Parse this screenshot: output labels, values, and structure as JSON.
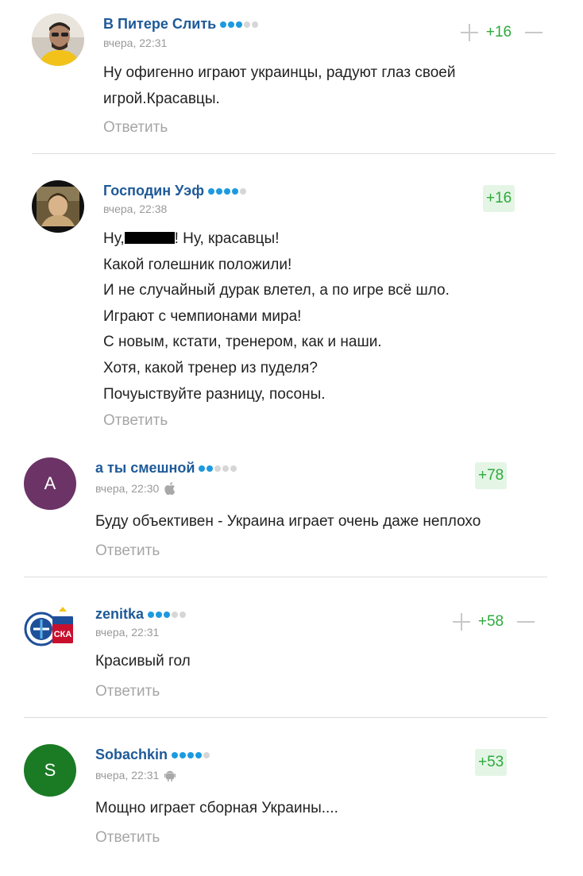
{
  "comments": [
    {
      "author": "В Питере Слить",
      "time": "вчера, 22:31",
      "rating_dots": 3,
      "score": "+16",
      "lines": [
        "Ну офигенно играют украинцы, радуют глаз своей",
        "игрой.Красавцы."
      ],
      "reply": "Ответить"
    },
    {
      "author": "Господин Уэф",
      "time": "вчера, 22:38",
      "rating_dots": 4,
      "score": "+16",
      "lines_first_pre": "Ну,",
      "lines_first_post": "! Ну, красавцы!",
      "lines": [
        "Какой голешник положили!",
        "И не случайный дурак влетел, а по игре всё шло.",
        "Играют с чемпионами мира!",
        "С новым, кстати, тренером, как и наши.",
        "Хотя, какой тренер из пуделя?",
        "Почуыствуйте разницу, посоны."
      ],
      "reply": "Ответить"
    },
    {
      "author": "а ты смешной",
      "time": "вчера, 22:30",
      "platform_icon": "apple-icon",
      "rating_dots": 2,
      "avatar_letter": "A",
      "avatar_color": "#6b3366",
      "score": "+78",
      "lines": [
        "Буду объективен - Украина играет очень даже неплохо"
      ],
      "reply": "Ответить"
    },
    {
      "author": "zenitka",
      "time": "вчера, 22:31",
      "rating_dots": 3,
      "score": "+58",
      "lines": [
        "Красивый гол"
      ],
      "reply": "Ответить"
    },
    {
      "author": "Sobachkin",
      "time": "вчера, 22:31",
      "platform_icon": "android-icon",
      "rating_dots": 4,
      "avatar_letter": "S",
      "avatar_color": "#1b7a24",
      "score": "+53",
      "lines": [
        "Мощно играет сборная Украины...."
      ],
      "reply": "Ответить"
    }
  ],
  "colors": {
    "author": "#1e5a98",
    "score": "#2eaa3c",
    "score_badge_bg": "#e4f5e6",
    "dot_on": "#1c9ae0",
    "dot_off": "#d6d6d6"
  }
}
